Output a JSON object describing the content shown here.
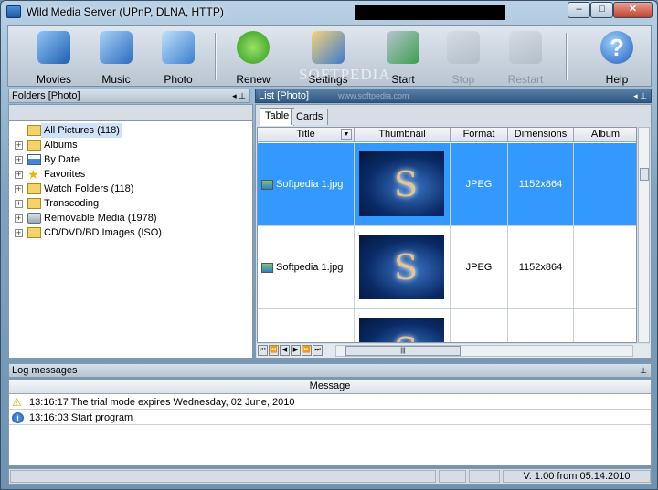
{
  "window": {
    "title": "Wild Media Server (UPnP, DLNA, HTTP)",
    "min": "–",
    "max": "□",
    "close": "✕"
  },
  "toolbar": {
    "movies": "Movies",
    "music": "Music",
    "photo": "Photo",
    "renew": "Renew",
    "settings": "Settings",
    "start": "Start",
    "stop": "Stop",
    "restart": "Restart",
    "help": "Help",
    "watermark": "SOFTPEDIA"
  },
  "folders": {
    "header": "Folders [Photo]",
    "pin": "◂ ⊥",
    "items": [
      {
        "label": "All Pictures (118)"
      },
      {
        "label": "Albums"
      },
      {
        "label": "By Date"
      },
      {
        "label": "Favorites"
      },
      {
        "label": "Watch Folders (118)"
      },
      {
        "label": "Transcoding"
      },
      {
        "label": "Removable Media (1978)"
      },
      {
        "label": "CD/DVD/BD Images (ISO)"
      }
    ]
  },
  "list": {
    "header": "List [Photo]",
    "watermark": "www.softpedia.com",
    "pin": "◂ ⊥",
    "tabs": [
      "Table",
      "Cards"
    ],
    "columns": [
      "Title",
      "Thumbnail",
      "Format",
      "Dimensions",
      "Album"
    ],
    "rows": [
      {
        "title": "Softpedia 1.jpg",
        "format": "JPEG",
        "dimensions": "1152x864"
      },
      {
        "title": "Softpedia 1.jpg",
        "format": "JPEG",
        "dimensions": "1152x864"
      }
    ],
    "scroll_grip": "|||"
  },
  "log": {
    "header": "Log messages",
    "pin": "⊥",
    "column": "Message",
    "rows": [
      {
        "text": "13:16:17 The trial mode expires Wednesday, 02 June, 2010",
        "icon": "warning-icon"
      },
      {
        "text": "13:16:03 Start program",
        "icon": "info-icon"
      }
    ]
  },
  "status": {
    "version": "V. 1.00 from 05.14.2010"
  }
}
